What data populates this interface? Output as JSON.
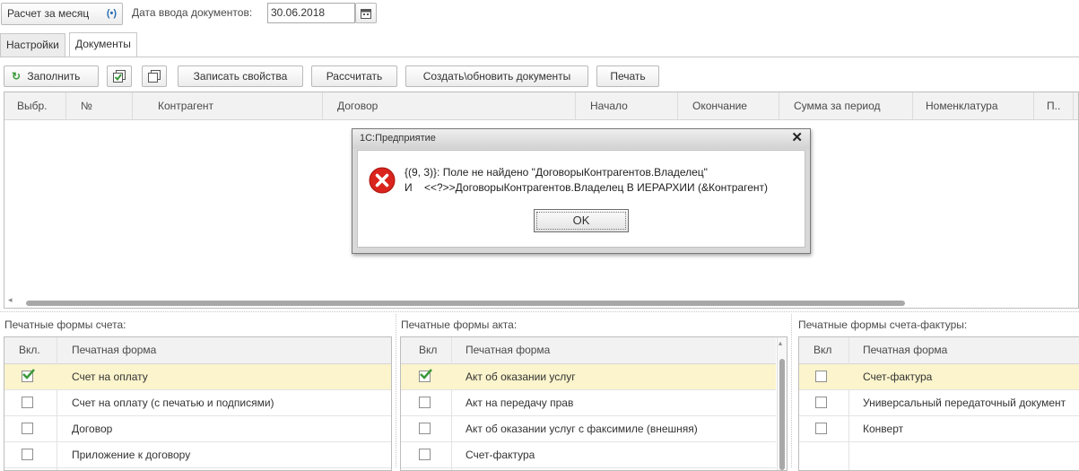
{
  "top": {
    "calc_button": "Расчет за месяц",
    "date_label": "Дата ввода документов:",
    "date_value": "30.06.2018"
  },
  "tabs": [
    "Настройки",
    "Документы"
  ],
  "toolbar": {
    "fill": "Заполнить",
    "write_props": "Записать свойства",
    "calculate": "Рассчитать",
    "create_docs": "Создать\\обновить документы",
    "print": "Печать"
  },
  "table": {
    "columns": [
      "Выбр.",
      "№",
      "Контрагент",
      "Договор",
      "Начало",
      "Окончание",
      "Сумма за период",
      "Номенклатура",
      "П.."
    ]
  },
  "dialog": {
    "title": "1С:Предприятие",
    "line1": "{(9, 3)}: Поле не найдено \"ДоговорыКонтрагентов.Владелец\"",
    "line2": "И    <<?>>ДоговорыКонтрагентов.Владелец В ИЕРАРХИИ (&Контрагент)",
    "ok": "OK"
  },
  "panels": [
    {
      "title": "Печатные формы счета:",
      "col_on": "Вкл.",
      "col_form": "Печатная форма",
      "rows": [
        {
          "checked": true,
          "label": "Счет на оплату"
        },
        {
          "checked": false,
          "label": "Счет на оплату (с печатью и подписями)"
        },
        {
          "checked": false,
          "label": "Договор"
        },
        {
          "checked": false,
          "label": "Приложение к договору"
        }
      ]
    },
    {
      "title": "Печатные формы акта:",
      "col_on": "Вкл",
      "col_form": "Печатная форма",
      "rows": [
        {
          "checked": true,
          "label": "Акт об оказании услуг"
        },
        {
          "checked": false,
          "label": "Акт на передачу прав"
        },
        {
          "checked": false,
          "label": "Акт об оказании услуг с факсимиле (внешняя)"
        },
        {
          "checked": false,
          "label": "Счет-фактура"
        }
      ]
    },
    {
      "title": "Печатные формы счета-фактуры:",
      "col_on": "Вкл",
      "col_form": "Печатная форма",
      "rows": [
        {
          "checked": false,
          "label": "Счет-фактура"
        },
        {
          "checked": false,
          "label": "Универсальный передаточный документ"
        },
        {
          "checked": false,
          "label": "Конверт"
        }
      ]
    }
  ],
  "colors": {
    "accent_green": "#3a9a3a",
    "highlight_row": "#fbf4cc",
    "error_red": "#d9251d"
  }
}
